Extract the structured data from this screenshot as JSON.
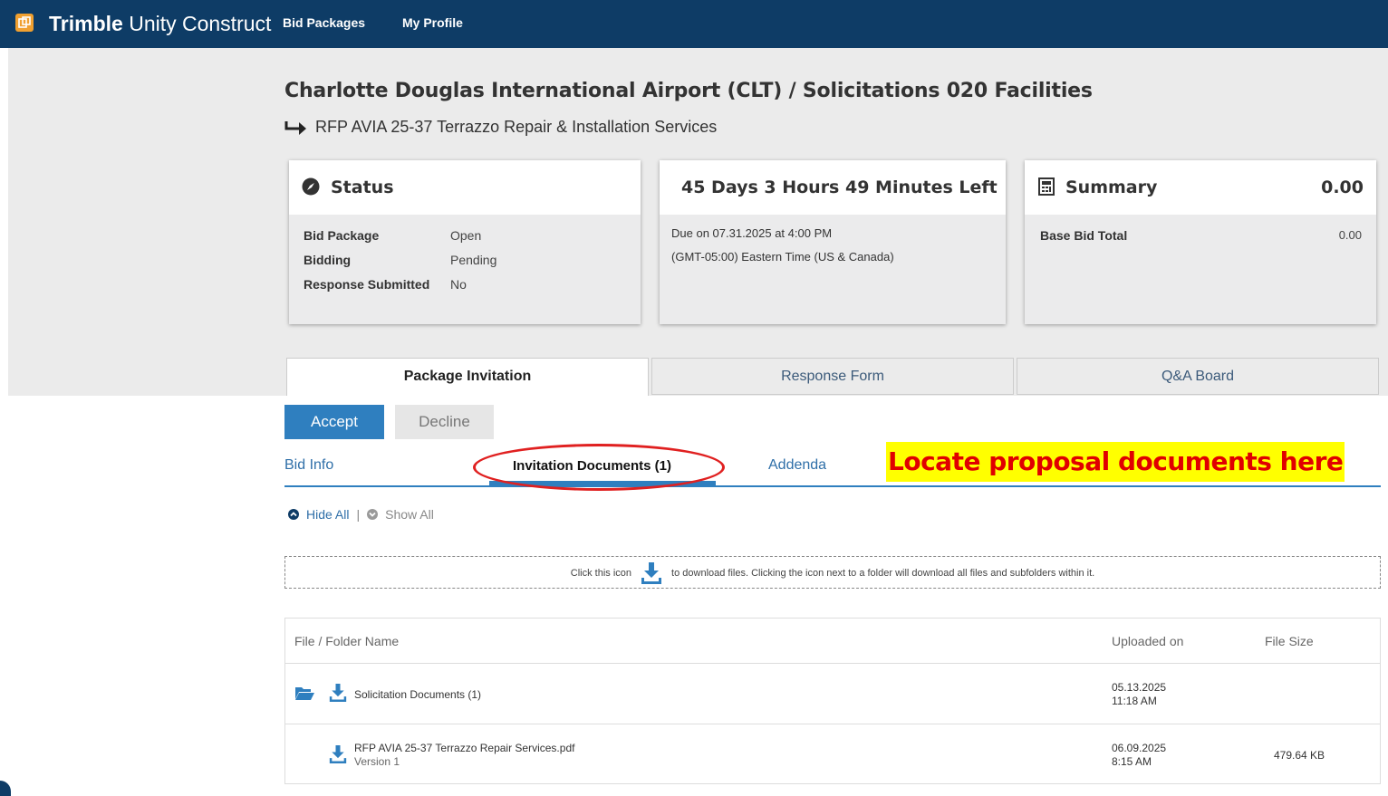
{
  "brand": {
    "bold": "Trimble",
    "rest": " Unity Construct"
  },
  "nav": {
    "bid_packages": "Bid Packages",
    "my_profile": "My Profile"
  },
  "header": {
    "title": "Charlotte Douglas International Airport (CLT) / Solicitations 020 Facilities",
    "subtitle": "RFP AVIA 25-37 Terrazzo Repair & Installation Services"
  },
  "status_card": {
    "title": "Status",
    "rows": [
      {
        "label": "Bid Package",
        "value": "Open"
      },
      {
        "label": "Bidding",
        "value": "Pending"
      },
      {
        "label": "Response Submitted",
        "value": "No"
      }
    ]
  },
  "time_card": {
    "title": "45 Days 3 Hours 49 Minutes Left",
    "due": "Due on 07.31.2025 at 4:00 PM",
    "timezone": "(GMT-05:00) Eastern Time (US & Canada)"
  },
  "summary_card": {
    "title": "Summary",
    "total": "0.00",
    "rows": [
      {
        "label": "Base Bid Total",
        "value": "0.00"
      }
    ]
  },
  "tabs": [
    "Package Invitation",
    "Response Form",
    "Q&A Board"
  ],
  "actions": {
    "accept": "Accept",
    "decline": "Decline"
  },
  "subtabs": [
    "Bid Info",
    "Invitation Documents (1)",
    "Addenda"
  ],
  "callout": "Locate proposal documents here",
  "toggles": {
    "hide_all": "Hide All",
    "separator": "|",
    "show_all": "Show All"
  },
  "download_info": {
    "before": "Click this icon",
    "after": "to download files. Clicking the icon next to a folder will download all files and subfolders within it."
  },
  "table": {
    "headers": {
      "name": "File / Folder Name",
      "uploaded": "Uploaded on",
      "size": "File Size"
    },
    "rows": [
      {
        "name": "Solicitation Documents (1)",
        "date": "05.13.2025",
        "time": "11:18 AM",
        "size": "",
        "version": ""
      },
      {
        "name": "RFP AVIA 25-37 Terrazzo Repair Services.pdf",
        "version": "Version 1",
        "date": "06.09.2025",
        "time": "8:15 AM",
        "size": "479.64 KB"
      }
    ]
  },
  "colors": {
    "nav_bg": "#0e3c66",
    "accent": "#2f7fbf",
    "logo": "#f0a030",
    "callout_bg": "#ffff00",
    "callout_text": "#e00000",
    "highlight_ring": "#e02020"
  }
}
